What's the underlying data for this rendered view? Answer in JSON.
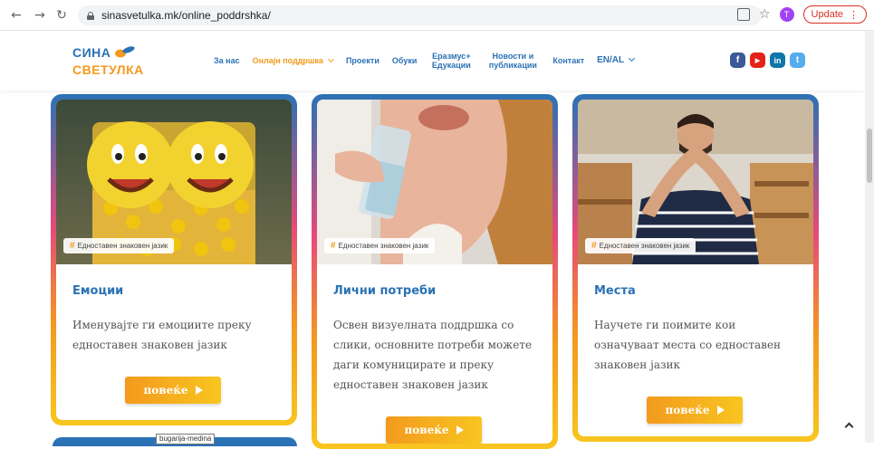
{
  "browser": {
    "url": "sinasvetulka.mk/online_poddrshka/",
    "profile_initial": "T",
    "update_label": "Update"
  },
  "logo": {
    "line1": "СИНА",
    "line2": "СВЕТУЛКА"
  },
  "menu": [
    {
      "label": "За нас",
      "active": false
    },
    {
      "label": "Онлајн поддршка",
      "active": true,
      "dropdown": true
    },
    {
      "label": "Проекти",
      "active": false
    },
    {
      "label": "Обуки",
      "active": false
    },
    {
      "label": "Еразмус+ Едукации",
      "active": false
    },
    {
      "label": "Новости и публикации",
      "active": false
    },
    {
      "label": "Контакт",
      "active": false
    },
    {
      "label": "EN/AL",
      "active": false,
      "dropdown": true
    }
  ],
  "socials": [
    {
      "name": "facebook-icon",
      "glyph": "f",
      "color": "#3b5998"
    },
    {
      "name": "youtube-icon",
      "glyph": "▶",
      "color": "#e62117"
    },
    {
      "name": "linkedin-icon",
      "glyph": "in",
      "color": "#0e76a8"
    },
    {
      "name": "twitter-icon",
      "glyph": "t",
      "color": "#55acee"
    }
  ],
  "cards": [
    {
      "tag": "Едноставен знаковен јазик",
      "title": "Емоции",
      "description": "Именувајте ги емоциите преку едноставен знаковен јазик",
      "button": "повеќе",
      "image": "smiley-balls"
    },
    {
      "tag": "Едноставен знаковен јазик",
      "title": "Лични потреби",
      "description": "Освен визуелната поддршка со слики, основните потреби можете даги комуницирате и преку едноставен знаковен јазик",
      "button": "повеќе",
      "image": "drinking-water"
    },
    {
      "tag": "Едноставен знаковен јазик",
      "title": "Места",
      "description": "Научете ги поимите кои означуваат места со едноставен знаковен јазик",
      "button": "повеќе",
      "image": "man-signing-house"
    }
  ],
  "tooltip": "bugarija-medina",
  "colors": {
    "brand_blue": "#2a72b5",
    "brand_orange": "#f39a1e",
    "brand_yellow": "#f8c51f",
    "brand_pink": "#e8497a"
  }
}
